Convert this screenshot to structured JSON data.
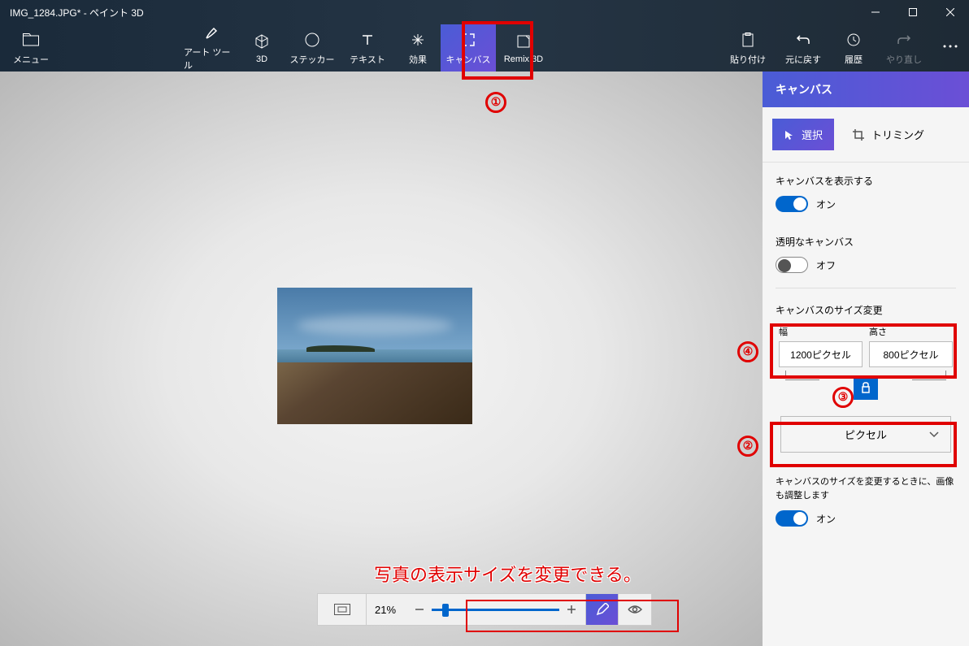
{
  "titlebar": {
    "text": "IMG_1284.JPG* - ペイント 3D"
  },
  "toolbar": {
    "menu": "メニュー",
    "art": "アート ツール",
    "3d": "3D",
    "sticker": "ステッカー",
    "text": "テキスト",
    "effects": "効果",
    "canvas": "キャンバス",
    "remix": "Remix 3D",
    "paste": "貼り付け",
    "undo": "元に戻す",
    "history": "履歴",
    "redo": "やり直し"
  },
  "zoom": {
    "pct": "21%"
  },
  "panel": {
    "title": "キャンバス",
    "select": "選択",
    "crop": "トリミング",
    "show_canvas": "キャンバスを表示する",
    "on": "オン",
    "transparent": "透明なキャンバス",
    "off": "オフ",
    "resize": "キャンバスのサイズ変更",
    "width_lbl": "幅",
    "height_lbl": "高さ",
    "width_val": "1200ピクセル",
    "height_val": "800ピクセル",
    "unit": "ピクセル",
    "resize_note": "キャンバスのサイズを変更するときに、画像も調整します"
  },
  "annotations": {
    "n1": "①",
    "n2": "②",
    "n3": "③",
    "n4": "④",
    "zoom_note": "写真の表示サイズを変更できる。"
  }
}
